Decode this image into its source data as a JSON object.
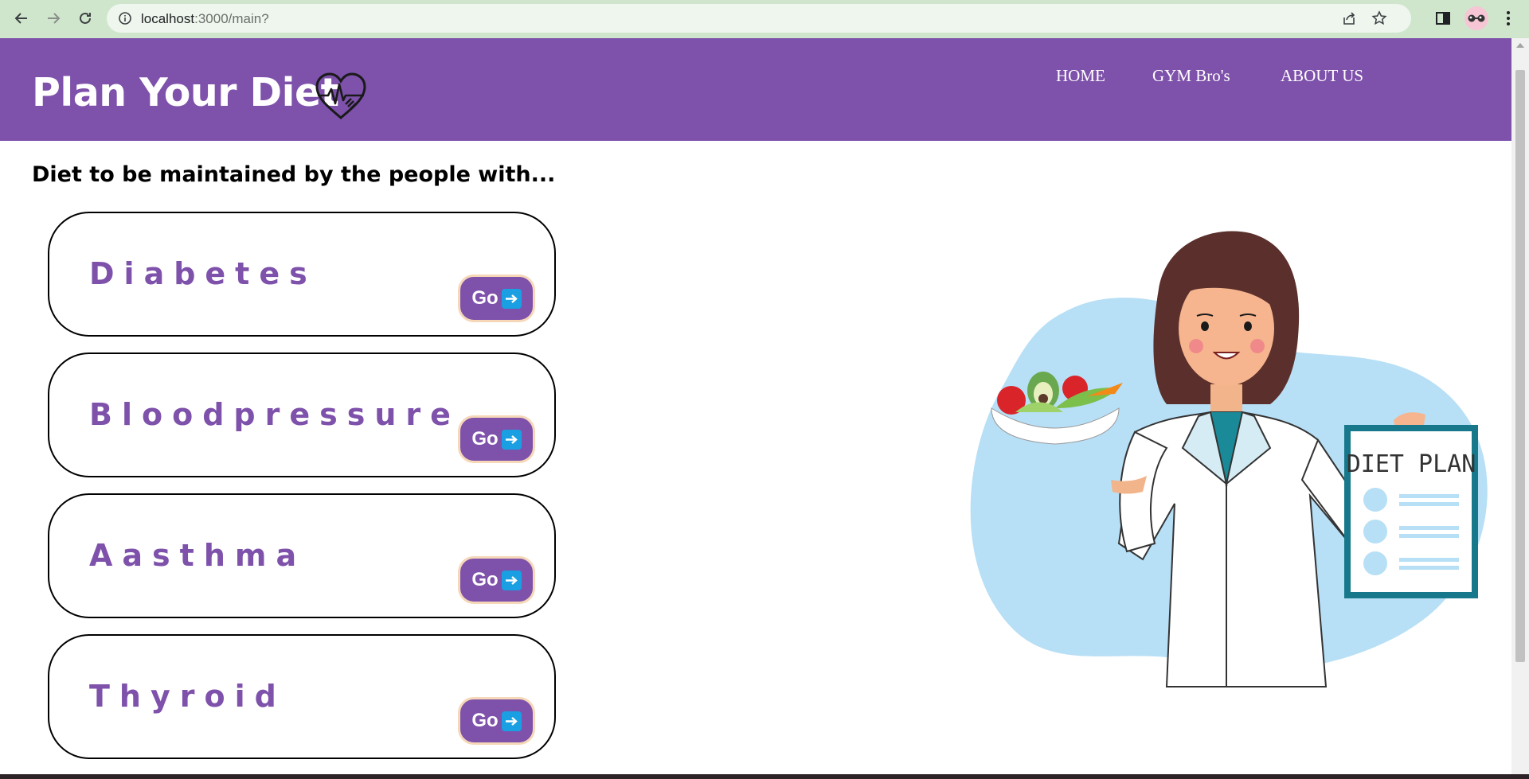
{
  "browser": {
    "url_host": "localhost",
    "url_rest": ":3000/main?"
  },
  "header": {
    "title": "Plan Your Diet",
    "logo_icon": "heart-pulse-icon",
    "nav": [
      {
        "label": "HOME"
      },
      {
        "label": "GYM Bro's"
      },
      {
        "label": "ABOUT US"
      }
    ]
  },
  "main": {
    "heading": "Diet to be maintained by the people with...",
    "cards": [
      {
        "label": "Diabetes",
        "button_label": "Go",
        "button_icon": "right-arrow-icon"
      },
      {
        "label": "Bloodpressure",
        "button_label": "Go",
        "button_icon": "right-arrow-icon"
      },
      {
        "label": "Aasthma",
        "button_label": "Go",
        "button_icon": "right-arrow-icon"
      },
      {
        "label": "Thyroid",
        "button_label": "Go",
        "button_icon": "right-arrow-icon"
      }
    ],
    "illustration": {
      "clipboard_text": "DIET PLAN"
    }
  },
  "colors": {
    "brand": "#7e51ab",
    "button_border": "#f6d7b8",
    "arrow_bg": "#1a9fe3",
    "illustration_blob": "#b7dff5"
  }
}
